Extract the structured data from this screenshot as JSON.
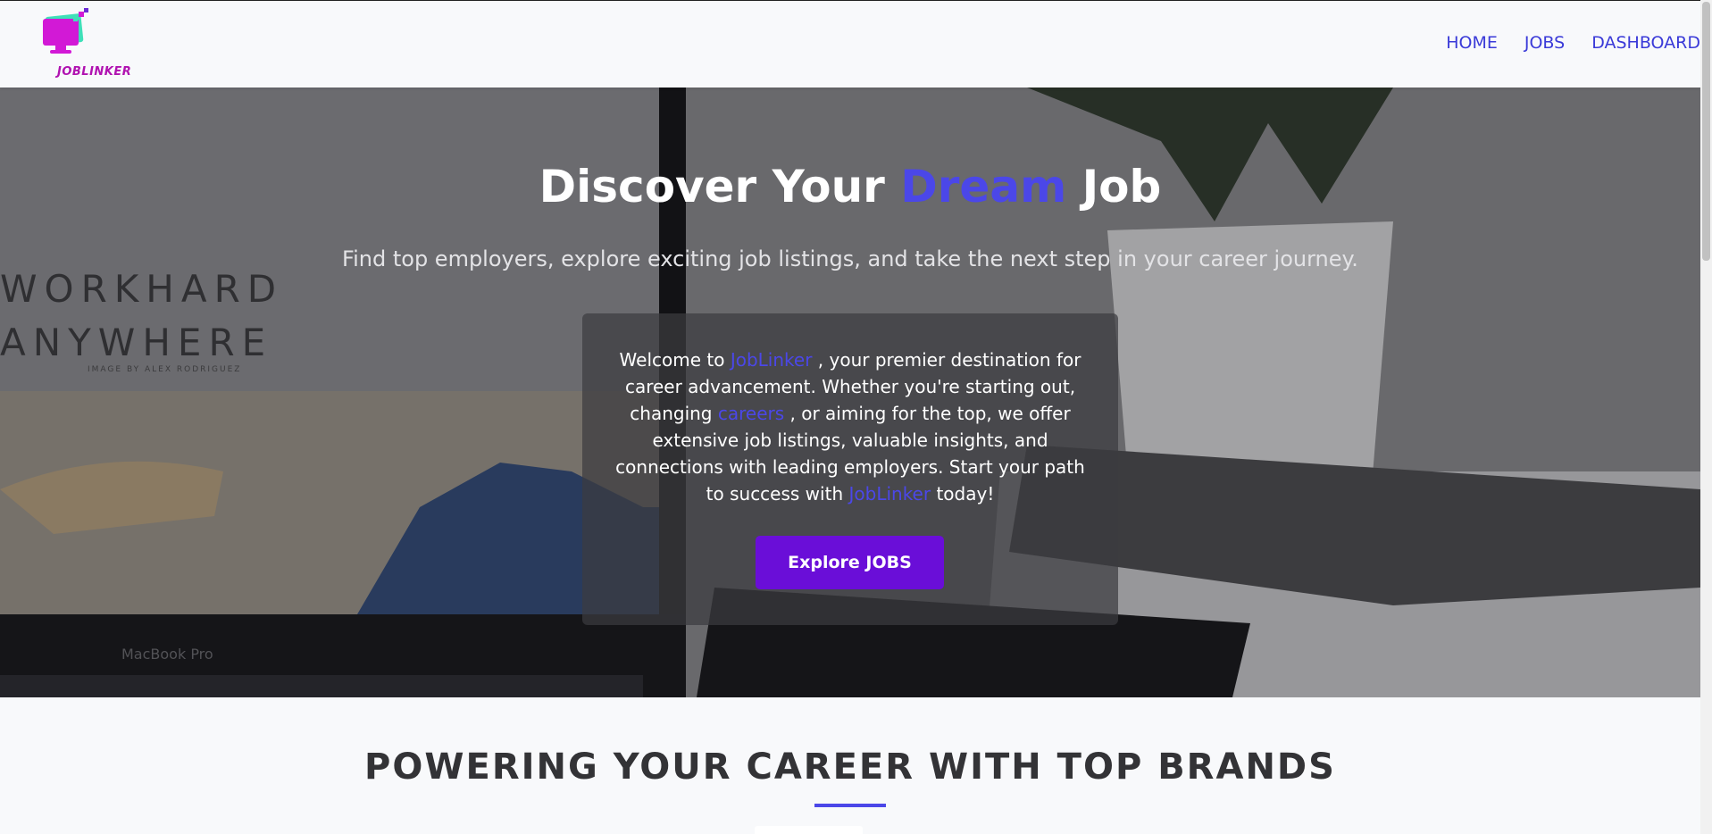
{
  "navbar": {
    "logo_text": "JOBLINKER",
    "links": [
      "HOME",
      "JOBS",
      "DASHBOARD"
    ]
  },
  "hero": {
    "title_part1": "Discover Your ",
    "title_accent": "Dream",
    "title_part2": " Job",
    "subtitle": "Find top employers, explore exciting job listings, and take the next step in your career journey.",
    "background_text": {
      "line1": "WORKHARD",
      "line2": "ANYWHERE",
      "credit": "IMAGE BY ALEX RODRIGUEZ",
      "laptop_label": "MacBook Pro"
    },
    "card": {
      "t1": "Welcome to ",
      "brand1": "JobLinker",
      "t2": " , your premier destination for career advancement. Whether you're starting out, changing ",
      "careers": "careers",
      "t3": " , or aiming for the top, we offer extensive job listings, valuable insights, and connections with leading employers. Start your path to success with ",
      "brand2": "JobLinker",
      "t4": " today!",
      "button": "Explore JOBS"
    }
  },
  "brands": {
    "title": "POWERING YOUR CAREER WITH TOP BRANDS"
  },
  "colors": {
    "accent": "#4b47e8",
    "button": "#6a0ed8",
    "logo": "#c41ccf"
  }
}
